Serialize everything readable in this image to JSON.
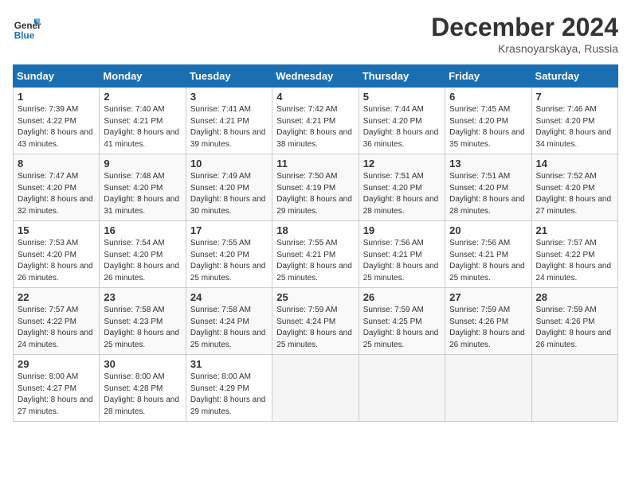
{
  "header": {
    "logo": {
      "line1": "General",
      "line2": "Blue"
    },
    "title": "December 2024",
    "subtitle": "Krasnoyarskaya, Russia"
  },
  "days_of_week": [
    "Sunday",
    "Monday",
    "Tuesday",
    "Wednesday",
    "Thursday",
    "Friday",
    "Saturday"
  ],
  "weeks": [
    [
      {
        "day": 1,
        "sunrise": "7:39 AM",
        "sunset": "4:22 PM",
        "daylight": "8 hours and 43 minutes."
      },
      {
        "day": 2,
        "sunrise": "7:40 AM",
        "sunset": "4:21 PM",
        "daylight": "8 hours and 41 minutes."
      },
      {
        "day": 3,
        "sunrise": "7:41 AM",
        "sunset": "4:21 PM",
        "daylight": "8 hours and 39 minutes."
      },
      {
        "day": 4,
        "sunrise": "7:42 AM",
        "sunset": "4:21 PM",
        "daylight": "8 hours and 38 minutes."
      },
      {
        "day": 5,
        "sunrise": "7:44 AM",
        "sunset": "4:20 PM",
        "daylight": "8 hours and 36 minutes."
      },
      {
        "day": 6,
        "sunrise": "7:45 AM",
        "sunset": "4:20 PM",
        "daylight": "8 hours and 35 minutes."
      },
      {
        "day": 7,
        "sunrise": "7:46 AM",
        "sunset": "4:20 PM",
        "daylight": "8 hours and 34 minutes."
      }
    ],
    [
      {
        "day": 8,
        "sunrise": "7:47 AM",
        "sunset": "4:20 PM",
        "daylight": "8 hours and 32 minutes."
      },
      {
        "day": 9,
        "sunrise": "7:48 AM",
        "sunset": "4:20 PM",
        "daylight": "8 hours and 31 minutes."
      },
      {
        "day": 10,
        "sunrise": "7:49 AM",
        "sunset": "4:20 PM",
        "daylight": "8 hours and 30 minutes."
      },
      {
        "day": 11,
        "sunrise": "7:50 AM",
        "sunset": "4:19 PM",
        "daylight": "8 hours and 29 minutes."
      },
      {
        "day": 12,
        "sunrise": "7:51 AM",
        "sunset": "4:20 PM",
        "daylight": "8 hours and 28 minutes."
      },
      {
        "day": 13,
        "sunrise": "7:51 AM",
        "sunset": "4:20 PM",
        "daylight": "8 hours and 28 minutes."
      },
      {
        "day": 14,
        "sunrise": "7:52 AM",
        "sunset": "4:20 PM",
        "daylight": "8 hours and 27 minutes."
      }
    ],
    [
      {
        "day": 15,
        "sunrise": "7:53 AM",
        "sunset": "4:20 PM",
        "daylight": "8 hours and 26 minutes."
      },
      {
        "day": 16,
        "sunrise": "7:54 AM",
        "sunset": "4:20 PM",
        "daylight": "8 hours and 26 minutes."
      },
      {
        "day": 17,
        "sunrise": "7:55 AM",
        "sunset": "4:20 PM",
        "daylight": "8 hours and 25 minutes."
      },
      {
        "day": 18,
        "sunrise": "7:55 AM",
        "sunset": "4:21 PM",
        "daylight": "8 hours and 25 minutes."
      },
      {
        "day": 19,
        "sunrise": "7:56 AM",
        "sunset": "4:21 PM",
        "daylight": "8 hours and 25 minutes."
      },
      {
        "day": 20,
        "sunrise": "7:56 AM",
        "sunset": "4:21 PM",
        "daylight": "8 hours and 25 minutes."
      },
      {
        "day": 21,
        "sunrise": "7:57 AM",
        "sunset": "4:22 PM",
        "daylight": "8 hours and 24 minutes."
      }
    ],
    [
      {
        "day": 22,
        "sunrise": "7:57 AM",
        "sunset": "4:22 PM",
        "daylight": "8 hours and 24 minutes."
      },
      {
        "day": 23,
        "sunrise": "7:58 AM",
        "sunset": "4:23 PM",
        "daylight": "8 hours and 25 minutes."
      },
      {
        "day": 24,
        "sunrise": "7:58 AM",
        "sunset": "4:24 PM",
        "daylight": "8 hours and 25 minutes."
      },
      {
        "day": 25,
        "sunrise": "7:59 AM",
        "sunset": "4:24 PM",
        "daylight": "8 hours and 25 minutes."
      },
      {
        "day": 26,
        "sunrise": "7:59 AM",
        "sunset": "4:25 PM",
        "daylight": "8 hours and 25 minutes."
      },
      {
        "day": 27,
        "sunrise": "7:59 AM",
        "sunset": "4:26 PM",
        "daylight": "8 hours and 26 minutes."
      },
      {
        "day": 28,
        "sunrise": "7:59 AM",
        "sunset": "4:26 PM",
        "daylight": "8 hours and 26 minutes."
      }
    ],
    [
      {
        "day": 29,
        "sunrise": "8:00 AM",
        "sunset": "4:27 PM",
        "daylight": "8 hours and 27 minutes."
      },
      {
        "day": 30,
        "sunrise": "8:00 AM",
        "sunset": "4:28 PM",
        "daylight": "8 hours and 28 minutes."
      },
      {
        "day": 31,
        "sunrise": "8:00 AM",
        "sunset": "4:29 PM",
        "daylight": "8 hours and 29 minutes."
      },
      null,
      null,
      null,
      null
    ]
  ]
}
